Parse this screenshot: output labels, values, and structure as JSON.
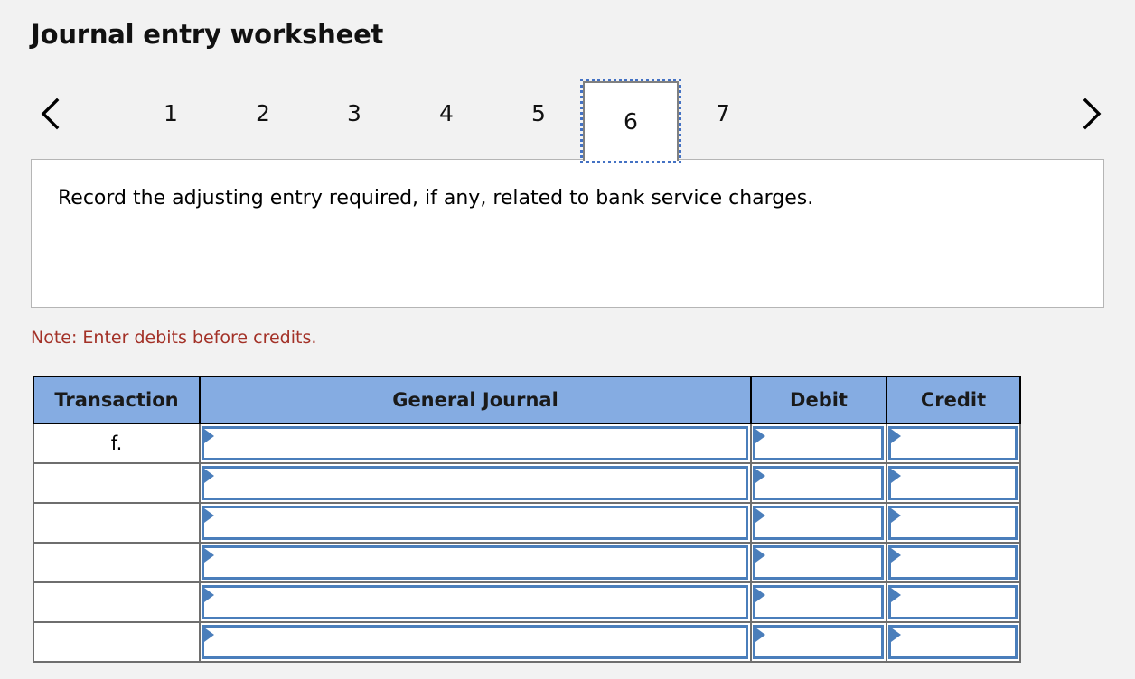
{
  "header": {
    "title": "Journal entry worksheet"
  },
  "tabs": {
    "prev_icon": "chevron-left-icon",
    "next_icon": "chevron-right-icon",
    "items": [
      {
        "label": "1",
        "selected": false
      },
      {
        "label": "2",
        "selected": false
      },
      {
        "label": "3",
        "selected": false
      },
      {
        "label": "4",
        "selected": false
      },
      {
        "label": "5",
        "selected": false
      },
      {
        "label": "6",
        "selected": true
      },
      {
        "label": "7",
        "selected": false
      }
    ],
    "selected_label": "6"
  },
  "question": {
    "text": "Record the adjusting entry required, if any, related to bank service charges."
  },
  "note": {
    "text": "Note: Enter debits before credits."
  },
  "table": {
    "columns": [
      {
        "key": "transaction",
        "label": "Transaction"
      },
      {
        "key": "general_journal",
        "label": "General Journal"
      },
      {
        "key": "debit",
        "label": "Debit"
      },
      {
        "key": "credit",
        "label": "Credit"
      }
    ],
    "rows": [
      {
        "transaction": "f.",
        "general_journal": "",
        "debit": "",
        "credit": ""
      },
      {
        "transaction": "",
        "general_journal": "",
        "debit": "",
        "credit": ""
      },
      {
        "transaction": "",
        "general_journal": "",
        "debit": "",
        "credit": ""
      },
      {
        "transaction": "",
        "general_journal": "",
        "debit": "",
        "credit": ""
      },
      {
        "transaction": "",
        "general_journal": "",
        "debit": "",
        "credit": ""
      },
      {
        "transaction": "",
        "general_journal": "",
        "debit": "",
        "credit": ""
      }
    ]
  },
  "colors": {
    "page_background": "#f2f2f2",
    "header_blue": "#85ace2",
    "input_border_blue": "#4a7ebb",
    "note_red": "#a33127",
    "focus_outline_blue": "#4472c4"
  }
}
